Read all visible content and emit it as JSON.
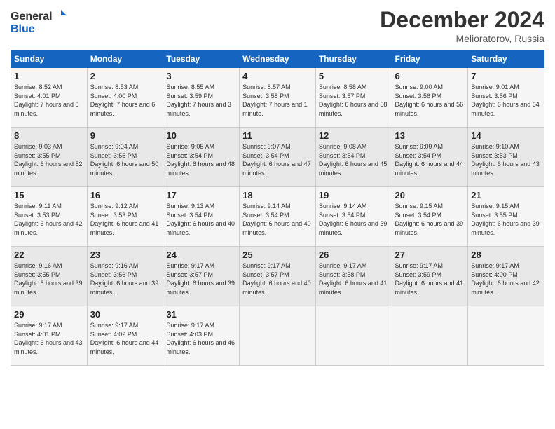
{
  "header": {
    "logo_line1": "General",
    "logo_line2": "Blue",
    "month": "December 2024",
    "location": "Melioratorov, Russia"
  },
  "days_of_week": [
    "Sunday",
    "Monday",
    "Tuesday",
    "Wednesday",
    "Thursday",
    "Friday",
    "Saturday"
  ],
  "weeks": [
    [
      {
        "day": "1",
        "sunrise": "8:52 AM",
        "sunset": "4:01 PM",
        "daylight": "7 hours and 8 minutes."
      },
      {
        "day": "2",
        "sunrise": "8:53 AM",
        "sunset": "4:00 PM",
        "daylight": "7 hours and 6 minutes."
      },
      {
        "day": "3",
        "sunrise": "8:55 AM",
        "sunset": "3:59 PM",
        "daylight": "7 hours and 3 minutes."
      },
      {
        "day": "4",
        "sunrise": "8:57 AM",
        "sunset": "3:58 PM",
        "daylight": "7 hours and 1 minute."
      },
      {
        "day": "5",
        "sunrise": "8:58 AM",
        "sunset": "3:57 PM",
        "daylight": "6 hours and 58 minutes."
      },
      {
        "day": "6",
        "sunrise": "9:00 AM",
        "sunset": "3:56 PM",
        "daylight": "6 hours and 56 minutes."
      },
      {
        "day": "7",
        "sunrise": "9:01 AM",
        "sunset": "3:56 PM",
        "daylight": "6 hours and 54 minutes."
      }
    ],
    [
      {
        "day": "8",
        "sunrise": "9:03 AM",
        "sunset": "3:55 PM",
        "daylight": "6 hours and 52 minutes."
      },
      {
        "day": "9",
        "sunrise": "9:04 AM",
        "sunset": "3:55 PM",
        "daylight": "6 hours and 50 minutes."
      },
      {
        "day": "10",
        "sunrise": "9:05 AM",
        "sunset": "3:54 PM",
        "daylight": "6 hours and 48 minutes."
      },
      {
        "day": "11",
        "sunrise": "9:07 AM",
        "sunset": "3:54 PM",
        "daylight": "6 hours and 47 minutes."
      },
      {
        "day": "12",
        "sunrise": "9:08 AM",
        "sunset": "3:54 PM",
        "daylight": "6 hours and 45 minutes."
      },
      {
        "day": "13",
        "sunrise": "9:09 AM",
        "sunset": "3:54 PM",
        "daylight": "6 hours and 44 minutes."
      },
      {
        "day": "14",
        "sunrise": "9:10 AM",
        "sunset": "3:53 PM",
        "daylight": "6 hours and 43 minutes."
      }
    ],
    [
      {
        "day": "15",
        "sunrise": "9:11 AM",
        "sunset": "3:53 PM",
        "daylight": "6 hours and 42 minutes."
      },
      {
        "day": "16",
        "sunrise": "9:12 AM",
        "sunset": "3:53 PM",
        "daylight": "6 hours and 41 minutes."
      },
      {
        "day": "17",
        "sunrise": "9:13 AM",
        "sunset": "3:54 PM",
        "daylight": "6 hours and 40 minutes."
      },
      {
        "day": "18",
        "sunrise": "9:14 AM",
        "sunset": "3:54 PM",
        "daylight": "6 hours and 40 minutes."
      },
      {
        "day": "19",
        "sunrise": "9:14 AM",
        "sunset": "3:54 PM",
        "daylight": "6 hours and 39 minutes."
      },
      {
        "day": "20",
        "sunrise": "9:15 AM",
        "sunset": "3:54 PM",
        "daylight": "6 hours and 39 minutes."
      },
      {
        "day": "21",
        "sunrise": "9:15 AM",
        "sunset": "3:55 PM",
        "daylight": "6 hours and 39 minutes."
      }
    ],
    [
      {
        "day": "22",
        "sunrise": "9:16 AM",
        "sunset": "3:55 PM",
        "daylight": "6 hours and 39 minutes."
      },
      {
        "day": "23",
        "sunrise": "9:16 AM",
        "sunset": "3:56 PM",
        "daylight": "6 hours and 39 minutes."
      },
      {
        "day": "24",
        "sunrise": "9:17 AM",
        "sunset": "3:57 PM",
        "daylight": "6 hours and 39 minutes."
      },
      {
        "day": "25",
        "sunrise": "9:17 AM",
        "sunset": "3:57 PM",
        "daylight": "6 hours and 40 minutes."
      },
      {
        "day": "26",
        "sunrise": "9:17 AM",
        "sunset": "3:58 PM",
        "daylight": "6 hours and 41 minutes."
      },
      {
        "day": "27",
        "sunrise": "9:17 AM",
        "sunset": "3:59 PM",
        "daylight": "6 hours and 41 minutes."
      },
      {
        "day": "28",
        "sunrise": "9:17 AM",
        "sunset": "4:00 PM",
        "daylight": "6 hours and 42 minutes."
      }
    ],
    [
      {
        "day": "29",
        "sunrise": "9:17 AM",
        "sunset": "4:01 PM",
        "daylight": "6 hours and 43 minutes."
      },
      {
        "day": "30",
        "sunrise": "9:17 AM",
        "sunset": "4:02 PM",
        "daylight": "6 hours and 44 minutes."
      },
      {
        "day": "31",
        "sunrise": "9:17 AM",
        "sunset": "4:03 PM",
        "daylight": "6 hours and 46 minutes."
      },
      null,
      null,
      null,
      null
    ]
  ]
}
